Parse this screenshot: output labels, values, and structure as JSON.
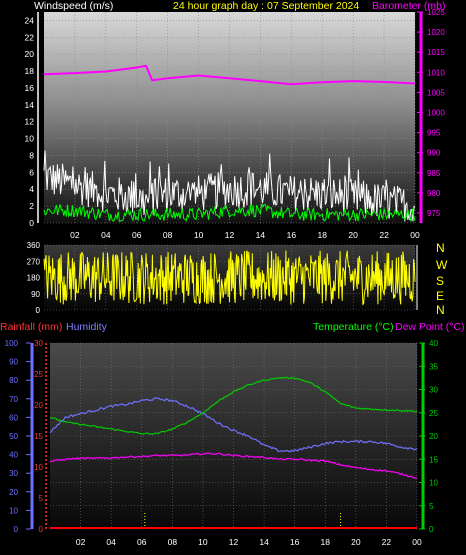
{
  "header": {
    "windspeed_label": "Windspeed (m/s)",
    "title": "24 hour graph day : 07 September 2024",
    "barometer_label": "Barometer (mb)"
  },
  "lower_header": {
    "rainfall_label": "Rainfall (mm)",
    "humidity_label": "Humidity",
    "temperature_label": "Temperature (°C)",
    "dewpoint_label": "Dew Point (°C)"
  },
  "x_ticks": [
    "02",
    "04",
    "06",
    "08",
    "10",
    "12",
    "14",
    "16",
    "18",
    "20",
    "22",
    "00"
  ],
  "compass": [
    "N",
    "W",
    "S",
    "E",
    "N"
  ],
  "colors": {
    "barometer": "#ff00ff",
    "windspeed": "#ffffff",
    "wind_avg": "#00ff00",
    "wind_direction": "#ffff00",
    "rainfall": "#ff0000",
    "humidity": "#7070ff",
    "temperature": "#00cc00",
    "dewpoint": "#ff00ff",
    "axis_yellow": "#ffff00"
  },
  "chart_data": [
    {
      "id": "wind-baro",
      "type": "line",
      "x_range": [
        0,
        24
      ],
      "x": [
        0,
        2,
        4,
        6,
        6.6,
        7,
        8,
        10,
        12,
        14,
        16,
        18,
        20,
        22,
        24
      ],
      "y_left": {
        "label": "Windspeed (m/s)",
        "lim": [
          0,
          25
        ],
        "ticks": [
          0,
          2,
          4,
          6,
          8,
          10,
          12,
          14,
          16,
          18,
          20,
          22,
          24
        ]
      },
      "y_right": {
        "label": "Barometer (mb)",
        "lim": [
          972.5,
          1025
        ],
        "ticks": [
          975,
          980,
          985,
          990,
          995,
          1000,
          1005,
          1010,
          1015,
          1020,
          1025
        ]
      },
      "series": [
        {
          "name": "Windspeed",
          "axis": "left",
          "values": [
            5.5,
            4.5,
            3.5,
            3,
            2.5,
            3,
            3.5,
            3.5,
            4,
            4,
            3.5,
            3.5,
            3,
            2.5,
            2
          ]
        },
        {
          "name": "Wind average",
          "axis": "left",
          "values": [
            1.5,
            1.5,
            1,
            1,
            1,
            1,
            1,
            1,
            1.5,
            1.5,
            1,
            1,
            1,
            1,
            1
          ]
        },
        {
          "name": "Barometer",
          "axis": "right",
          "values": [
            1009.5,
            1009.8,
            1010.2,
            1011.2,
            1011.6,
            1008,
            1008.5,
            1009.2,
            1008.5,
            1007.8,
            1007,
            1007.5,
            1007.8,
            1007.6,
            1007.2
          ]
        }
      ],
      "grid": true
    },
    {
      "id": "wind-direction",
      "type": "line",
      "x_range": [
        0,
        24
      ],
      "y_left": {
        "lim": [
          0,
          360
        ],
        "ticks": [
          0,
          90,
          180,
          270,
          360
        ]
      },
      "series": [
        {
          "name": "Wind direction",
          "min": 30,
          "max": 330
        }
      ],
      "grid": true
    },
    {
      "id": "temp-hum-rain",
      "type": "line",
      "x_range": [
        0,
        24
      ],
      "x": [
        0,
        1,
        2,
        3,
        4,
        5,
        6,
        7,
        8,
        9,
        10,
        11,
        12,
        13,
        14,
        15,
        16,
        17,
        18,
        19,
        20,
        21,
        22,
        23,
        24
      ],
      "y_left_humidity": {
        "label": "Humidity",
        "lim": [
          0,
          100
        ],
        "ticks": [
          0,
          10,
          20,
          30,
          40,
          50,
          60,
          70,
          80,
          90,
          100
        ]
      },
      "y_left_rain": {
        "label": "Rainfall (mm)",
        "lim": [
          0,
          30
        ],
        "ticks": [
          0,
          5,
          10,
          15,
          20,
          25,
          30
        ]
      },
      "y_right": {
        "label": "Temperature (°C)",
        "lim": [
          0,
          40
        ],
        "ticks": [
          0,
          5,
          10,
          15,
          20,
          25,
          30,
          35,
          40
        ]
      },
      "series": [
        {
          "name": "Humidity",
          "axis": "humidity",
          "values": [
            52,
            60,
            62,
            64,
            66,
            67,
            69,
            70,
            69,
            66,
            62,
            57,
            53,
            50,
            45,
            42,
            42,
            44,
            46,
            47,
            47,
            47,
            46,
            44,
            43
          ]
        },
        {
          "name": "Temperature",
          "axis": "right",
          "values": [
            24,
            23,
            22.5,
            22,
            21.5,
            21,
            20.5,
            20.5,
            21.5,
            23,
            25,
            27.5,
            29.5,
            31,
            32,
            32.5,
            32.5,
            31.5,
            29.5,
            27,
            26,
            25.8,
            25.6,
            25.5,
            25.3
          ]
        },
        {
          "name": "Dew Point",
          "axis": "right",
          "values": [
            14.5,
            15,
            15.2,
            15.2,
            15.3,
            15.5,
            15.6,
            15.8,
            15.8,
            15.9,
            16.2,
            16.2,
            15.8,
            15.6,
            15.4,
            15,
            15,
            14.8,
            14.6,
            13.8,
            13.2,
            12.8,
            12.5,
            11.8,
            11
          ]
        },
        {
          "name": "Rainfall",
          "axis": "rain",
          "values": [
            0,
            0,
            0,
            0,
            0,
            0,
            0,
            0,
            0,
            0,
            0,
            0,
            0,
            0,
            0,
            0,
            0,
            0,
            0,
            0,
            0,
            0,
            0,
            0,
            0
          ]
        }
      ],
      "grid": true
    }
  ]
}
